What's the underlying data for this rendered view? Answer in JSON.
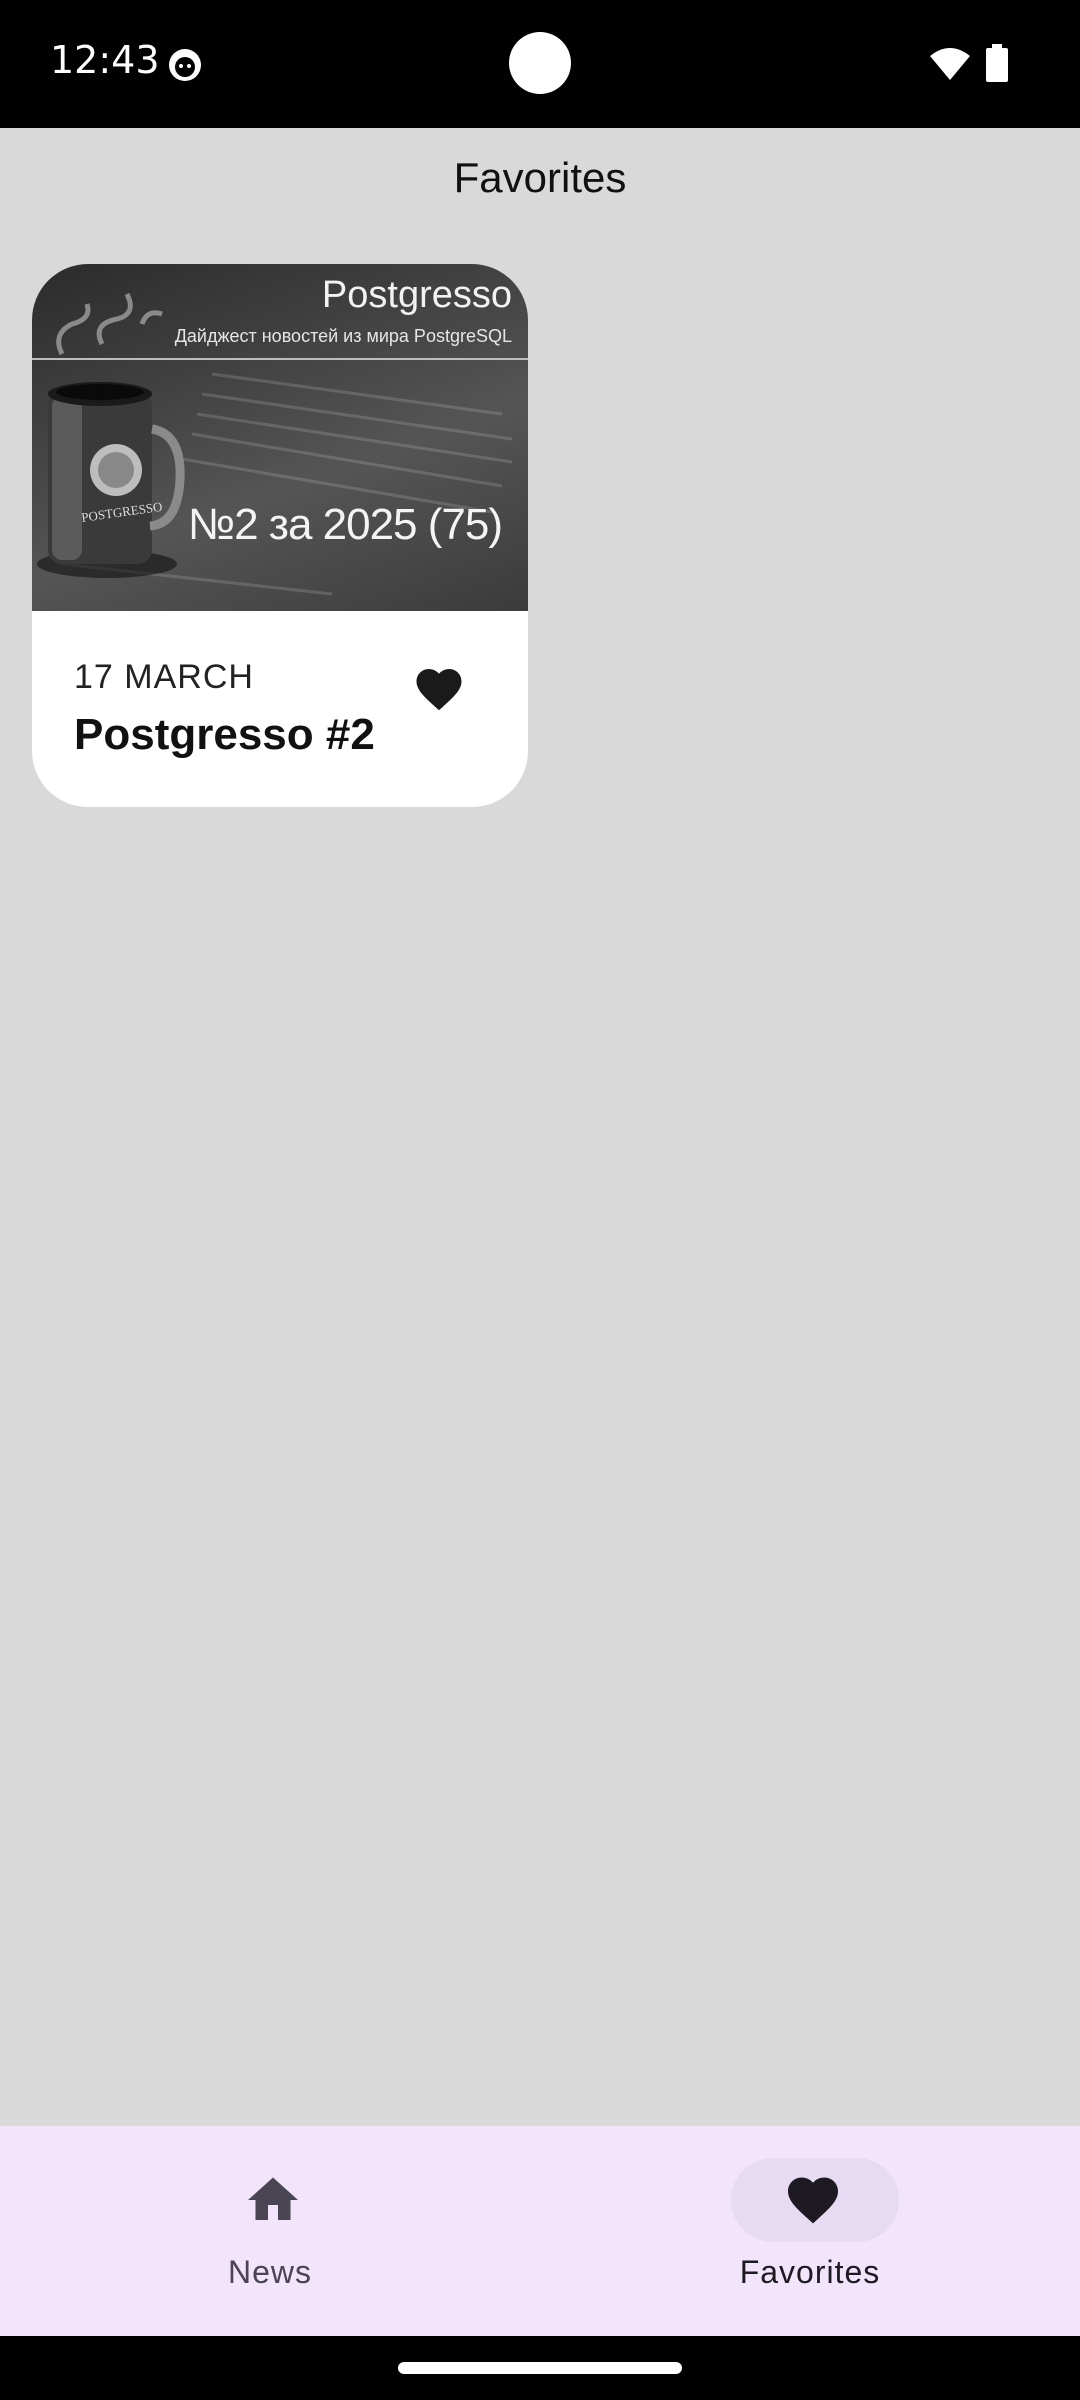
{
  "status_bar": {
    "time": "12:43",
    "icons": [
      "android-notification-icon",
      "camera-cutout",
      "wifi-icon",
      "battery-icon"
    ]
  },
  "header": {
    "title": "Favorites"
  },
  "favorites": [
    {
      "cover": {
        "title": "Postgresso",
        "subtitle": "Дайджест новостей из мира PostgreSQL",
        "issue": "№2 за 2025 (75)"
      },
      "date": "17 MARCH",
      "title": "Postgresso #2",
      "favorite_icon": "heart-filled-icon",
      "is_favorite": true
    }
  ],
  "bottom_nav": {
    "items": [
      {
        "label": "News",
        "icon": "home-icon",
        "selected": false
      },
      {
        "label": "Favorites",
        "icon": "heart-icon",
        "selected": true
      }
    ]
  },
  "colors": {
    "screen_background": "#d9d9d9",
    "card_background": "#ffffff",
    "nav_background": "#f2e4fa",
    "nav_active_pill": "#e6dbf2",
    "icon_dark": "#1d1a24"
  }
}
